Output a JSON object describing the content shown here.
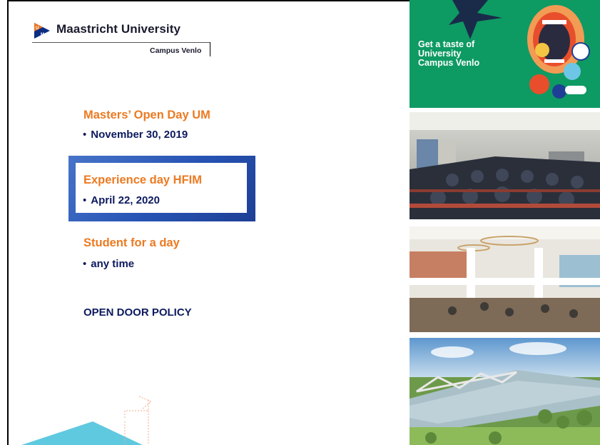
{
  "logo": {
    "university": "Maastricht University",
    "campus": "Campus Venlo",
    "mark_colors": [
      "#0c2d83",
      "#e87722"
    ]
  },
  "events": [
    {
      "title": "Masters’ Open Day UM",
      "date": "November 30, 2019"
    },
    {
      "title": "Experience day HFIM",
      "date": "April 22, 2020"
    },
    {
      "title": "Student for a day",
      "date": "any time"
    }
  ],
  "policy": "OPEN DOOR POLICY",
  "bullet_glyph": "•",
  "promo": {
    "lines": [
      "Get a taste of",
      "University",
      "Campus Venlo"
    ]
  },
  "colors": {
    "title_orange": "#ec7a22",
    "text_navy": "#0c1a5e",
    "box_blue": "#2f5ebf",
    "promo_green": "#0e9a63"
  }
}
